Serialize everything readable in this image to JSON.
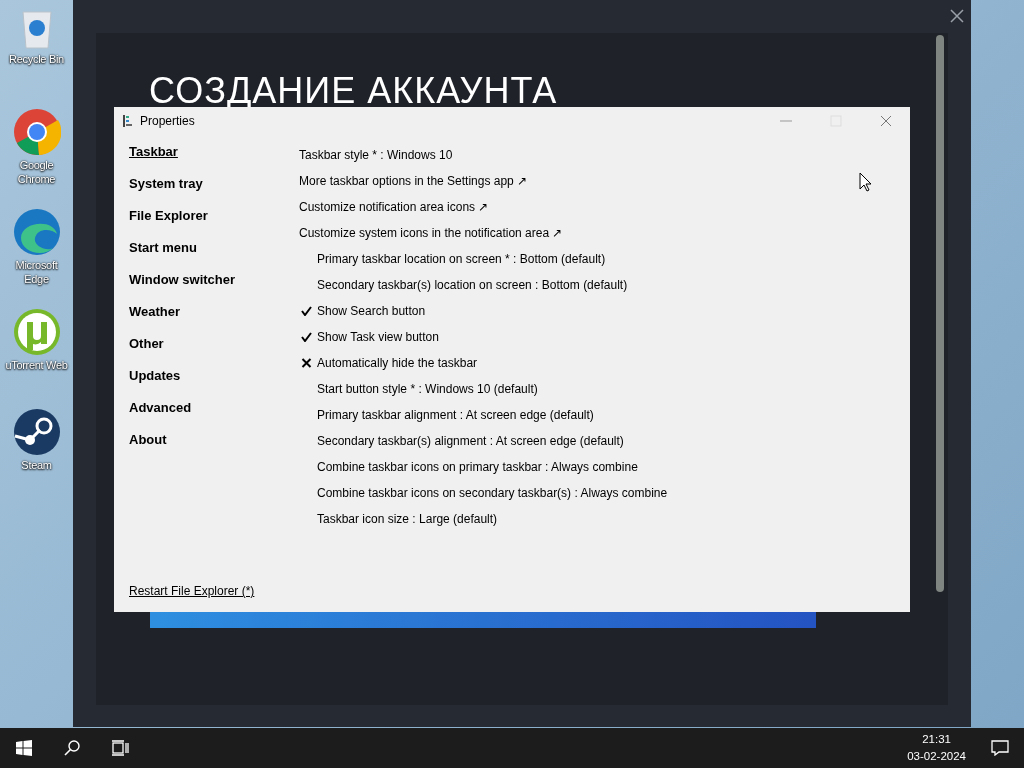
{
  "desktop_icons": [
    {
      "label": "Recycle Bin",
      "kind": "bin"
    },
    {
      "label": "Google Chrome",
      "kind": "chrome"
    },
    {
      "label": "Microsoft Edge",
      "kind": "edge"
    },
    {
      "label": "uTorrent Web",
      "kind": "torrent"
    },
    {
      "label": "Steam",
      "kind": "steam"
    }
  ],
  "background_app": {
    "heading": "СОЗДАНИЕ АККАУНТА"
  },
  "properties_window": {
    "title": "Properties",
    "sidebar": [
      {
        "label": "Taskbar",
        "selected": true
      },
      {
        "label": "System tray",
        "selected": false
      },
      {
        "label": "File Explorer",
        "selected": false
      },
      {
        "label": "Start menu",
        "selected": false
      },
      {
        "label": "Window switcher",
        "selected": false
      },
      {
        "label": "Weather",
        "selected": false
      },
      {
        "label": "Other",
        "selected": false
      },
      {
        "label": "Updates",
        "selected": false
      },
      {
        "label": "Advanced",
        "selected": false
      },
      {
        "label": "About",
        "selected": false
      }
    ],
    "settings": [
      {
        "kind": "value",
        "text": "Taskbar style * : Windows 10"
      },
      {
        "kind": "link",
        "text": "More taskbar options in the Settings app ↗"
      },
      {
        "kind": "link",
        "text": "Customize notification area icons ↗"
      },
      {
        "kind": "link",
        "text": "Customize system icons in the notification area ↗"
      },
      {
        "kind": "option",
        "text": "Primary taskbar location on screen * : Bottom (default)"
      },
      {
        "kind": "option",
        "text": "Secondary taskbar(s) location on screen : Bottom (default)"
      },
      {
        "kind": "toggle",
        "text": "Show Search button",
        "checked": true
      },
      {
        "kind": "toggle",
        "text": "Show Task view button",
        "checked": true
      },
      {
        "kind": "toggle",
        "text": "Automatically hide the taskbar",
        "checked": false
      },
      {
        "kind": "option",
        "text": "Start button style * : Windows 10 (default)"
      },
      {
        "kind": "option",
        "text": "Primary taskbar alignment : At screen edge (default)"
      },
      {
        "kind": "option",
        "text": "Secondary taskbar(s) alignment : At screen edge (default)"
      },
      {
        "kind": "option",
        "text": "Combine taskbar icons on primary taskbar : Always combine"
      },
      {
        "kind": "option",
        "text": "Combine taskbar icons on secondary taskbar(s) : Always combine"
      },
      {
        "kind": "option",
        "text": "Taskbar icon size : Large (default)"
      }
    ],
    "footer_link": "Restart File Explorer (*)"
  },
  "taskbar": {
    "time": "21:31",
    "date": "03-02-2024"
  }
}
